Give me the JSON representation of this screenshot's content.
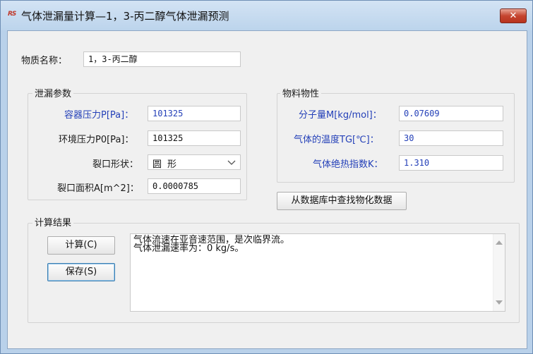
{
  "window": {
    "title": "气体泄漏量计算—1，3-丙二醇气体泄漏预测",
    "app_icon_text": "RS",
    "close_label": "✕"
  },
  "substance": {
    "label": "物质名称：",
    "value": "1，3-丙二醇"
  },
  "leak_params": {
    "title": "泄漏参数",
    "vessel_pressure": {
      "label": "容器压力P[Pa]：",
      "value": "101325"
    },
    "ambient_pressure": {
      "label": "环境压力P0[Pa]：",
      "value": "101325"
    },
    "crack_shape": {
      "label": "裂口形状：",
      "value": "圆形"
    },
    "crack_area": {
      "label": "裂口面积A[m^2]：",
      "value": "0.0000785"
    }
  },
  "properties": {
    "title": "物料物性",
    "molecular_weight": {
      "label": "分子量M[kg/mol]：",
      "value": "0.07609"
    },
    "gas_temperature": {
      "label": "气体的温度TG[℃]：",
      "value": "30"
    },
    "adiabatic_index": {
      "label": "气体绝热指数K：",
      "value": "1.310"
    }
  },
  "lookup_button": "从数据库中查找物化数据",
  "results": {
    "title": "计算结果",
    "calc_button": "计算(C)",
    "save_button": "保存(S)",
    "lines": [
      "气体流速在亚音速范围，是次临界流。",
      "气体泄漏速率为：0 kg/s。"
    ]
  },
  "colors": {
    "title_bar": "#bcd4ec",
    "label_blue": "#2440b8",
    "close_red": "#c5452f"
  }
}
